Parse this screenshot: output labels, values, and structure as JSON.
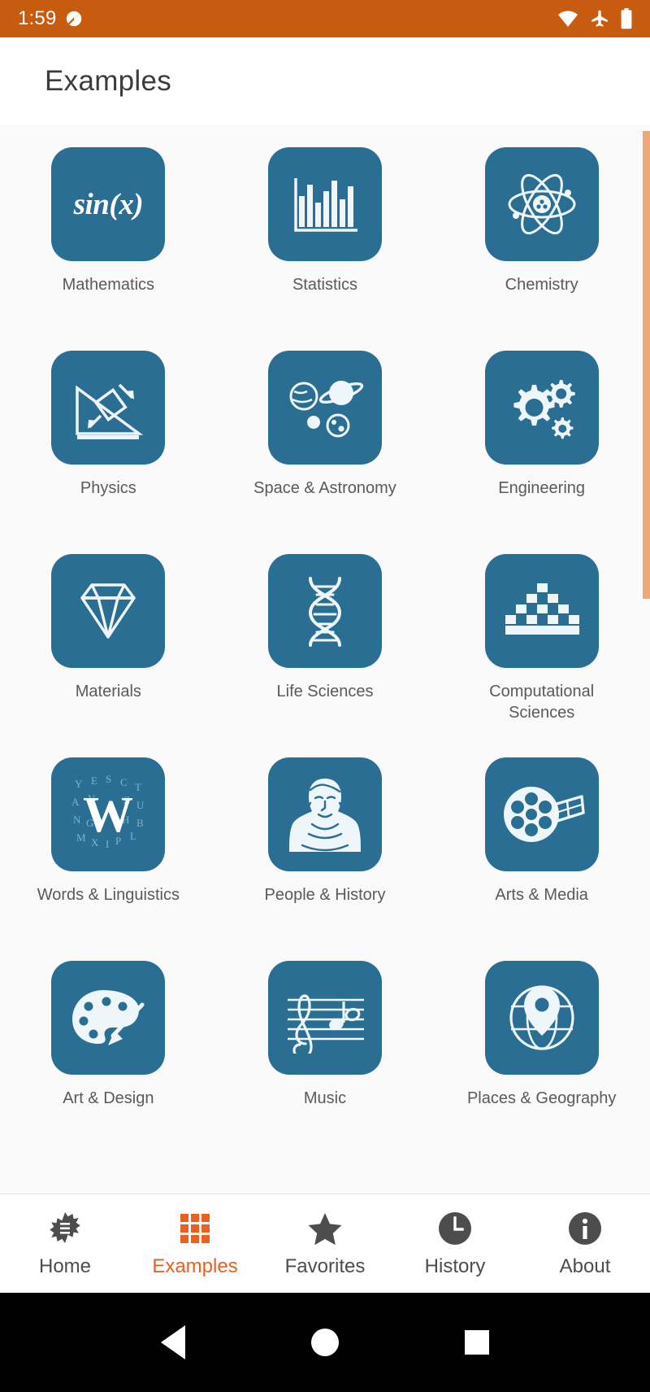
{
  "status_bar": {
    "time": "1:59",
    "notification_icon": "notification-badge-icon",
    "icons": [
      "wifi-icon",
      "airplane-mode-icon",
      "battery-icon"
    ],
    "background_color": "#c75b10"
  },
  "app_bar": {
    "title": "Examples"
  },
  "theme": {
    "tile_color": "#2a6f93",
    "accent_color": "#ec5f1f",
    "page_background": "#fafafa",
    "scrollbar_color": "#f0a878"
  },
  "grid": {
    "items": [
      {
        "label": "Mathematics",
        "icon": "sin-x-icon",
        "glyph": "sin(x)"
      },
      {
        "label": "Statistics",
        "icon": "bar-chart-icon"
      },
      {
        "label": "Chemistry",
        "icon": "atom-icon"
      },
      {
        "label": "Physics",
        "icon": "inclined-plane-icon"
      },
      {
        "label": "Space & Astronomy",
        "icon": "planets-icon"
      },
      {
        "label": "Engineering",
        "icon": "gears-icon"
      },
      {
        "label": "Materials",
        "icon": "diamond-icon"
      },
      {
        "label": "Life Sciences",
        "icon": "dna-icon"
      },
      {
        "label": "Computational Sciences",
        "icon": "pyramid-blocks-icon"
      },
      {
        "label": "Words & Linguistics",
        "icon": "letter-w-icon",
        "glyph": "W"
      },
      {
        "label": "People & History",
        "icon": "portrait-bust-icon"
      },
      {
        "label": "Arts & Media",
        "icon": "film-reel-icon"
      },
      {
        "label": "Art & Design",
        "icon": "palette-brush-icon"
      },
      {
        "label": "Music",
        "icon": "music-staff-icon"
      },
      {
        "label": "Places & Geography",
        "icon": "globe-pin-icon"
      }
    ]
  },
  "bottom_nav": {
    "items": [
      {
        "label": "Home",
        "icon": "spikeburst-home-icon",
        "active": false
      },
      {
        "label": "Examples",
        "icon": "grid-3x3-icon",
        "active": true
      },
      {
        "label": "Favorites",
        "icon": "star-icon",
        "active": false
      },
      {
        "label": "History",
        "icon": "clock-icon",
        "active": false
      },
      {
        "label": "About",
        "icon": "info-circle-icon",
        "active": false
      }
    ]
  },
  "system_nav": {
    "back": "back-triangle-icon",
    "home": "home-circle-icon",
    "recents": "recents-square-icon"
  }
}
